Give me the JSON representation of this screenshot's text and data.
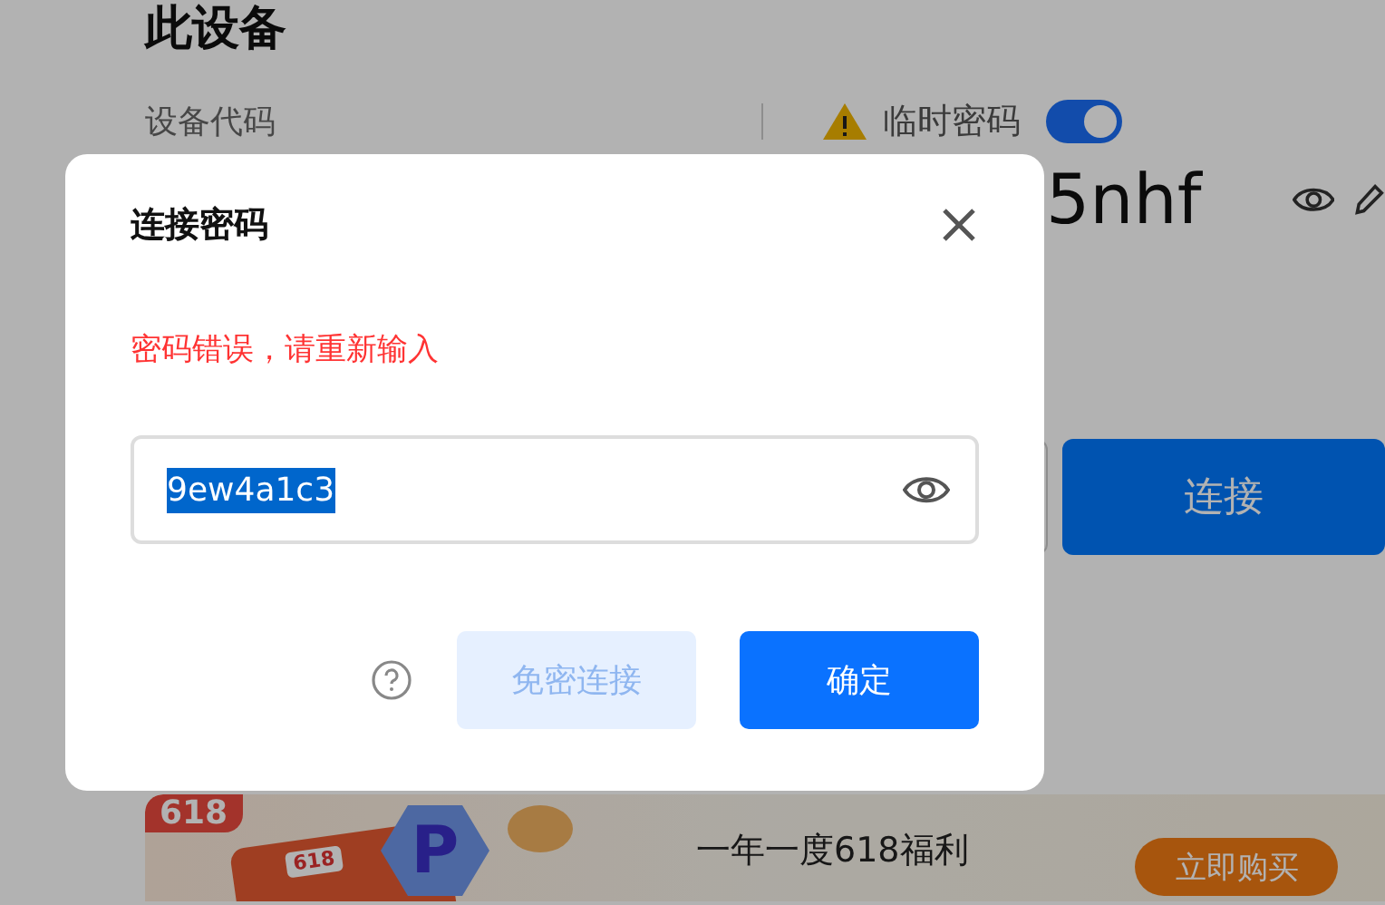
{
  "page": {
    "title": "此设备",
    "device_code_label": "设备代码",
    "temp_password": {
      "label": "临时密码",
      "on": true
    },
    "password_tail": "5nhf",
    "connect_button": "连接"
  },
  "banner": {
    "badge": "618",
    "envelope_label": "618",
    "icon_letter": "P",
    "headline": "一年一度618福利",
    "buy_button": "立即购买"
  },
  "dialog": {
    "title": "连接密码",
    "error": "密码错误，请重新输入",
    "field": {
      "value": "9ew4a1c3",
      "text_selected": true
    },
    "secondary_button": {
      "label": "免密连接",
      "disabled": true
    },
    "primary_button": "确定"
  }
}
